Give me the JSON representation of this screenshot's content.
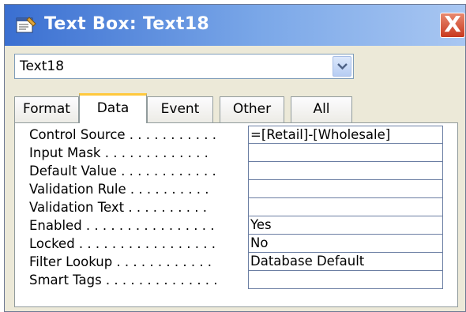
{
  "window": {
    "title": "Text Box: Text18",
    "close_label": "X"
  },
  "selector": {
    "value": "Text18"
  },
  "tabs": [
    {
      "label": "Format",
      "active": false
    },
    {
      "label": "Data",
      "active": true
    },
    {
      "label": "Event",
      "active": false
    },
    {
      "label": "Other",
      "active": false
    },
    {
      "label": "All",
      "active": false
    }
  ],
  "properties": [
    {
      "label": "Control Source . . . . . . . . . . .",
      "value": "=[Retail]-[Wholesale]"
    },
    {
      "label": "Input Mask . . . . . . . . . . . . .",
      "value": ""
    },
    {
      "label": "Default Value . . . . . . . . . . . .",
      "value": ""
    },
    {
      "label": "Validation Rule . . . . . . . . . .",
      "value": ""
    },
    {
      "label": "Validation Text . . . . . . . . . .",
      "value": ""
    },
    {
      "label": "Enabled . . . . . . . . . . . . . . . .",
      "value": "Yes"
    },
    {
      "label": "Locked . . . . . . . . . . . . . . . . .",
      "value": "No"
    },
    {
      "label": "Filter Lookup . . . . . . . . . . . .",
      "value": "Database Default"
    },
    {
      "label": "Smart Tags . . . . . . . . . . . . . .",
      "value": ""
    }
  ],
  "icons": {
    "title": "properties-icon",
    "dropdown": "chevron-down-icon",
    "close": "close-icon"
  },
  "colors": {
    "titlebar": "#3a6fd1",
    "active_tab_accent": "#ffc83c",
    "close_button": "#c8391f"
  }
}
